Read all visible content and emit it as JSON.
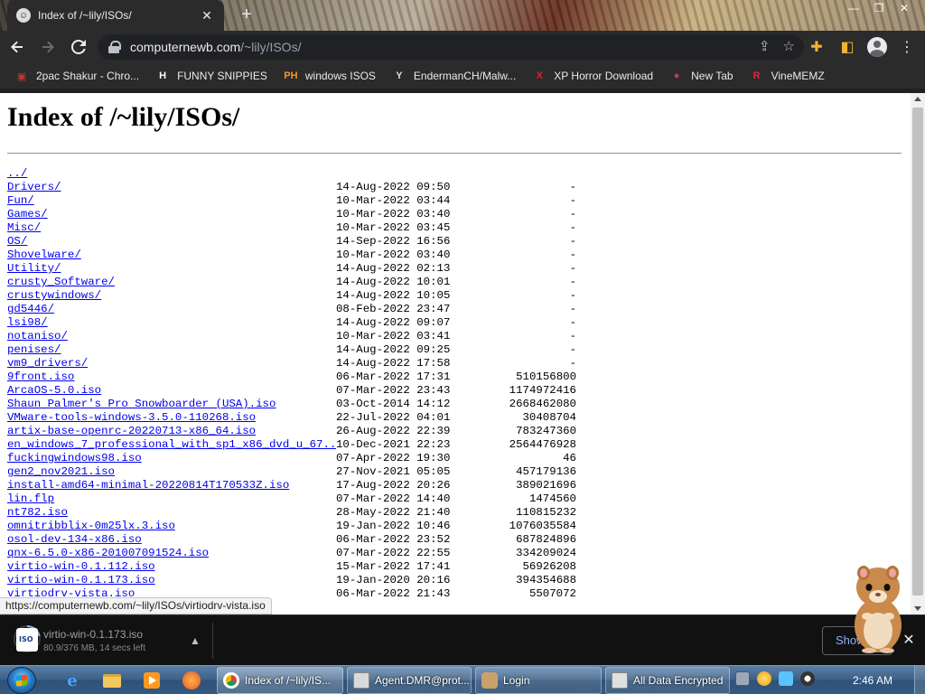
{
  "browser": {
    "tab": {
      "title": "Index of /~lily/ISOs/",
      "close": "✕"
    },
    "new_tab": "+",
    "window_controls": {
      "minimize": "—",
      "maximize": "❐",
      "close": "✕"
    },
    "address": {
      "host": "computernewb.com",
      "path": "/~lily/ISOs/"
    },
    "bookmarks": [
      {
        "label": "2pac Shakur - Chro...",
        "icon": "2pac-icon",
        "glyph": "▣",
        "color": "#c0392b"
      },
      {
        "label": "FUNNY SNIPPIES",
        "icon": "h-logo-icon",
        "glyph": "H",
        "color": "#ffffff"
      },
      {
        "label": "windows ISOS",
        "icon": "ph-logo-icon",
        "glyph": "PH",
        "color": "#f7971d"
      },
      {
        "label": "EndermanCH/Malw...",
        "icon": "yp-logo-icon",
        "glyph": "Y",
        "color": "#dddddd"
      },
      {
        "label": "XP Horror Download",
        "icon": "x-logo-icon",
        "glyph": "X",
        "color": "#e02020"
      },
      {
        "label": "New Tab",
        "icon": "globe-icon",
        "glyph": "●",
        "color": "#b03a7a"
      },
      {
        "label": "VineMEMZ",
        "icon": "r-logo-icon",
        "glyph": "R",
        "color": "#e0263a"
      }
    ]
  },
  "page": {
    "heading": "Index of /~lily/ISOs/",
    "parent_link": "../",
    "entries": [
      {
        "name": "Drivers/",
        "date": "14-Aug-2022 09:50",
        "size": "-"
      },
      {
        "name": "Fun/",
        "date": "10-Mar-2022 03:44",
        "size": "-"
      },
      {
        "name": "Games/",
        "date": "10-Mar-2022 03:40",
        "size": "-"
      },
      {
        "name": "Misc/",
        "date": "10-Mar-2022 03:45",
        "size": "-"
      },
      {
        "name": "OS/",
        "date": "14-Sep-2022 16:56",
        "size": "-"
      },
      {
        "name": "Shovelware/",
        "date": "10-Mar-2022 03:40",
        "size": "-"
      },
      {
        "name": "Utility/",
        "date": "14-Aug-2022 02:13",
        "size": "-"
      },
      {
        "name": "crusty_Software/",
        "date": "14-Aug-2022 10:01",
        "size": "-"
      },
      {
        "name": "crustywindows/",
        "date": "14-Aug-2022 10:05",
        "size": "-"
      },
      {
        "name": "gd5446/",
        "date": "08-Feb-2022 23:47",
        "size": "-"
      },
      {
        "name": "lsi98/",
        "date": "14-Aug-2022 09:07",
        "size": "-"
      },
      {
        "name": "notaniso/",
        "date": "10-Mar-2022 03:41",
        "size": "-"
      },
      {
        "name": "penises/",
        "date": "14-Aug-2022 09:25",
        "size": "-"
      },
      {
        "name": "vm9_drivers/",
        "date": "14-Aug-2022 17:58",
        "size": "-"
      },
      {
        "name": "9front.iso",
        "date": "06-Mar-2022 17:31",
        "size": "510156800"
      },
      {
        "name": "ArcaOS-5.0.iso",
        "date": "07-Mar-2022 23:43",
        "size": "1174972416"
      },
      {
        "name": "Shaun Palmer's Pro Snowboarder (USA).iso",
        "date": "03-Oct-2014 14:12",
        "size": "2668462080"
      },
      {
        "name": "VMware-tools-windows-3.5.0-110268.iso",
        "date": "22-Jul-2022 04:01",
        "size": "30408704"
      },
      {
        "name": "artix-base-openrc-20220713-x86_64.iso",
        "date": "26-Aug-2022 22:39",
        "size": "783247360"
      },
      {
        "name": "en_windows_7_professional_with_sp1_x86_dvd_u_67..>",
        "date": "10-Dec-2021 22:23",
        "size": "2564476928"
      },
      {
        "name": "fuckingwindows98.iso",
        "date": "07-Apr-2022 19:30",
        "size": "46"
      },
      {
        "name": "gen2_nov2021.iso",
        "date": "27-Nov-2021 05:05",
        "size": "457179136"
      },
      {
        "name": "install-amd64-minimal-20220814T170533Z.iso",
        "date": "17-Aug-2022 20:26",
        "size": "389021696"
      },
      {
        "name": "lin.flp",
        "date": "07-Mar-2022 14:40",
        "size": "1474560"
      },
      {
        "name": "nt782.iso",
        "date": "28-May-2022 21:40",
        "size": "110815232"
      },
      {
        "name": "omnitribblix-0m25lx.3.iso",
        "date": "19-Jan-2022 10:46",
        "size": "1076035584"
      },
      {
        "name": "osol-dev-134-x86.iso",
        "date": "06-Mar-2022 23:52",
        "size": "687824896"
      },
      {
        "name": "qnx-6.5.0-x86-201007091524.iso",
        "date": "07-Mar-2022 22:55",
        "size": "334209024"
      },
      {
        "name": "virtio-win-0.1.112.iso",
        "date": "15-Mar-2022 17:41",
        "size": "56926208"
      },
      {
        "name": "virtio-win-0.1.173.iso",
        "date": "19-Jan-2020 20:16",
        "size": "394354688"
      },
      {
        "name": "virtiodrv-vista.iso",
        "date": "06-Mar-2022 21:43",
        "size": "5507072"
      }
    ],
    "status_url": "https://computernewb.com/~lily/ISOs/virtiodrv-vista.iso"
  },
  "download_bar": {
    "file_name": "virtio-win-0.1.173.iso",
    "progress_text": "80.9/376 MB, 14 secs left",
    "progress_fraction": 0.215,
    "show_all": "Show all",
    "close": "✕"
  },
  "taskbar": {
    "tasks": [
      {
        "label": "Index of /~lily/IS..."
      },
      {
        "label": "Agent.DMR@prot..."
      },
      {
        "label": "Login"
      },
      {
        "label": "All Data Encrypted"
      }
    ],
    "clock": "2:46 AM"
  }
}
